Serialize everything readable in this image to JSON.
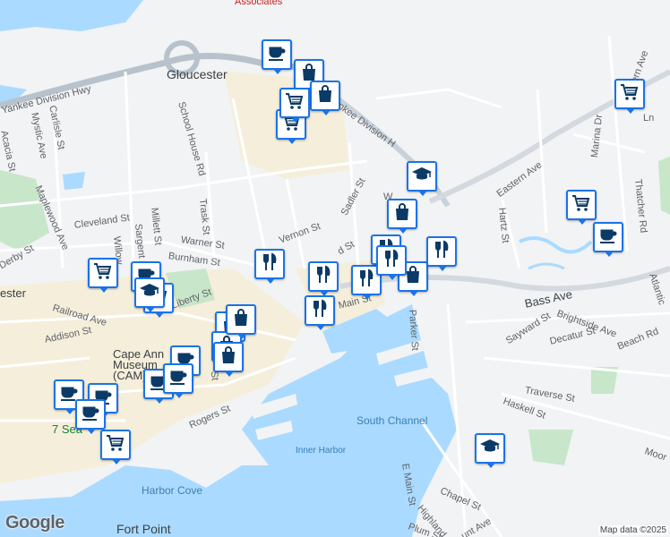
{
  "labels": {
    "top_cut": "Associates",
    "gloucester": "Gloucester",
    "yankee_hwy_w": "Yankee Division Hwy",
    "yankee_hwy_e": "Yankee Division H",
    "carlisle": "Carlisle St",
    "mystic": "Mystic Ave",
    "acacia": "Acacia St",
    "school_house": "School House Rd",
    "maplewood": "Maplewood Ave",
    "cleveland": "Cleveland St",
    "derby": "Derby St",
    "willow": "Willow",
    "sargent": "Sargent St",
    "millett": "Millett St",
    "trask": "Trask St",
    "warner": "Warner St",
    "burnham": "Burnham St",
    "vernon": "Vernon St",
    "sadler": "Sadler St",
    "railroad": "Railroad Ave",
    "liberty": "Liberty St",
    "addison": "Addison St",
    "ester": "ester",
    "museum": "Cape Ann Museum (CAM)",
    "rogers": "Rogers St",
    "seven_seas": "7 Sea",
    "south_channel": "South Channel",
    "inner_harbor": "Inner Harbor",
    "harbor_cove": "Harbor Cove",
    "fort_point": "Fort Point",
    "eastern_ave": "Eastern Ave",
    "hartz": "Hartz St",
    "marina_dr": "Marina Dr",
    "thatcher": "Thatcher Rd",
    "atlantic": "Atlantic",
    "bass_ave": "Bass Ave",
    "sayward": "Sayward St",
    "brightside": "Brightside Ave",
    "decatur": "Decatur St",
    "beach_rd": "Beach Rd",
    "parker": "Parker St",
    "traverse": "Traverse St",
    "haskell": "Haskell St",
    "moore": "Moor",
    "e_main": "E Main St",
    "chapel": "Chapel St",
    "highland": "Highland",
    "plum": "Plum St",
    "mount_ave": "unt Ave",
    "n_ave": "ern Ave",
    "ln": "Ln",
    "w_st": "W",
    "d_st": "d St",
    "st_small": "St",
    "mstn": "Main St"
  },
  "markers": [
    {
      "icon": "coffee"
    },
    {
      "icon": "shopping-bag"
    },
    {
      "icon": "shopping-cart"
    },
    {
      "icon": "shopping-bag"
    },
    {
      "icon": "shopping-cart"
    },
    {
      "icon": "school"
    },
    {
      "icon": "shopping-bag"
    },
    {
      "icon": "restaurant"
    },
    {
      "icon": "restaurant"
    },
    {
      "icon": "restaurant"
    },
    {
      "icon": "restaurant"
    },
    {
      "icon": "restaurant"
    },
    {
      "icon": "shopping-bag"
    },
    {
      "icon": "restaurant"
    },
    {
      "icon": "restaurant"
    },
    {
      "icon": "shopping-cart"
    },
    {
      "icon": "shopping-cart"
    },
    {
      "icon": "coffee"
    },
    {
      "icon": "shopping-cart"
    },
    {
      "icon": "coffee"
    },
    {
      "icon": "school"
    },
    {
      "icon": "shopping-cart"
    },
    {
      "icon": "shopping-bag"
    },
    {
      "icon": "shopping-bag"
    },
    {
      "icon": "shopping-bag"
    },
    {
      "icon": "shopping-bag"
    },
    {
      "icon": "coffee"
    },
    {
      "icon": "coffee"
    },
    {
      "icon": "coffee"
    },
    {
      "icon": "coffee"
    },
    {
      "icon": "coffee"
    },
    {
      "icon": "coffee"
    },
    {
      "icon": "shopping-cart"
    },
    {
      "icon": "school"
    }
  ],
  "branding": {
    "logo": "Google",
    "attribution": "Map data ©2025"
  },
  "colors": {
    "water": "#aadaff",
    "park": "#c8e6c9",
    "urban": "#f5eedb",
    "road": "#ffffff",
    "highway": "#b8c2cc",
    "marker_border": "#1a73e8",
    "marker_icon": "#0b3a66"
  }
}
